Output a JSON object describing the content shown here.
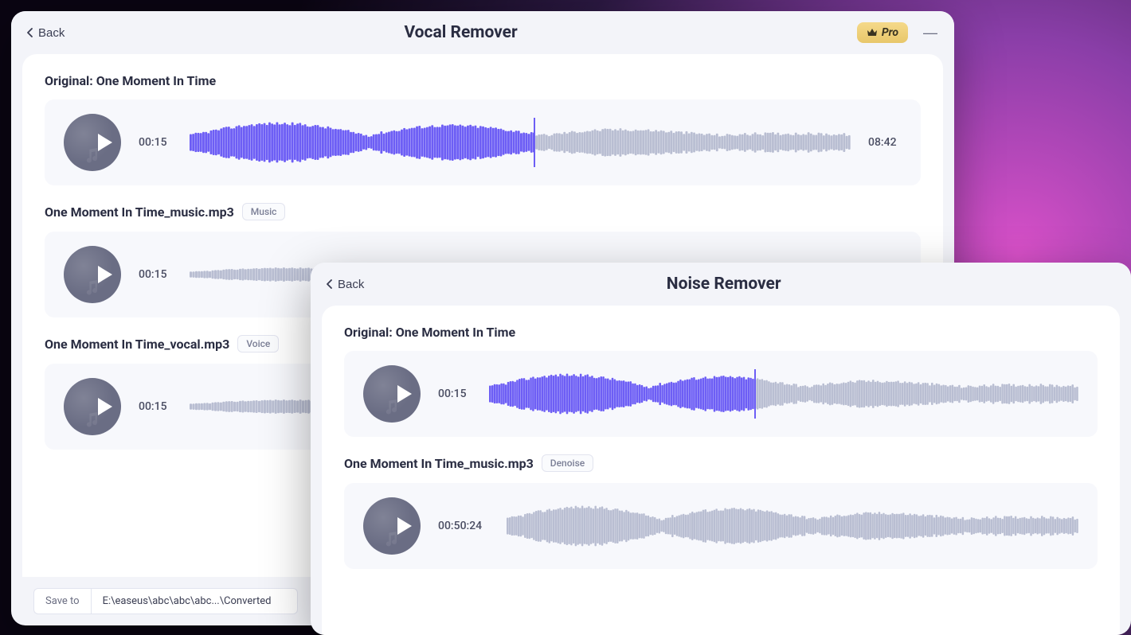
{
  "vocal_window": {
    "back_label": "Back",
    "title": "Vocal Remover",
    "pro_label": "Pro",
    "tracks": [
      {
        "title_prefix": "Original: ",
        "title": "One Moment In Time",
        "tag": null,
        "time_current": "00:15",
        "time_total": "08:42",
        "progress": 0.52,
        "color_played": "#6d5ef5",
        "color_rest": "#b9bed2"
      },
      {
        "title": "One Moment In Time_music.mp3",
        "tag": "Music",
        "time_current": "00:15",
        "time_total": null,
        "progress": 0,
        "color_played": "#b9bed2",
        "color_rest": "#b9bed2"
      },
      {
        "title": "One Moment In Time_vocal.mp3",
        "tag": "Voice",
        "time_current": "00:15",
        "time_total": null,
        "progress": 0,
        "color_played": "#b9bed2",
        "color_rest": "#b9bed2"
      }
    ],
    "save_to_label": "Save to",
    "save_to_path": "E:\\easeus\\abc\\abc\\abc...\\Converted"
  },
  "noise_window": {
    "back_label": "Back",
    "title": "Noise Remover",
    "tracks": [
      {
        "title_prefix": "Original: ",
        "title": "One Moment In Time",
        "tag": null,
        "time_current": "00:15",
        "time_total": null,
        "progress": 0.45,
        "color_played": "#6d5ef5",
        "color_rest": "#b9bed2"
      },
      {
        "title": "One Moment In Time_music.mp3",
        "tag": "Denoise",
        "time_current": "00:50:24",
        "time_total": null,
        "progress": 0,
        "color_played": "#b9bed2",
        "color_rest": "#b9bed2"
      }
    ]
  }
}
